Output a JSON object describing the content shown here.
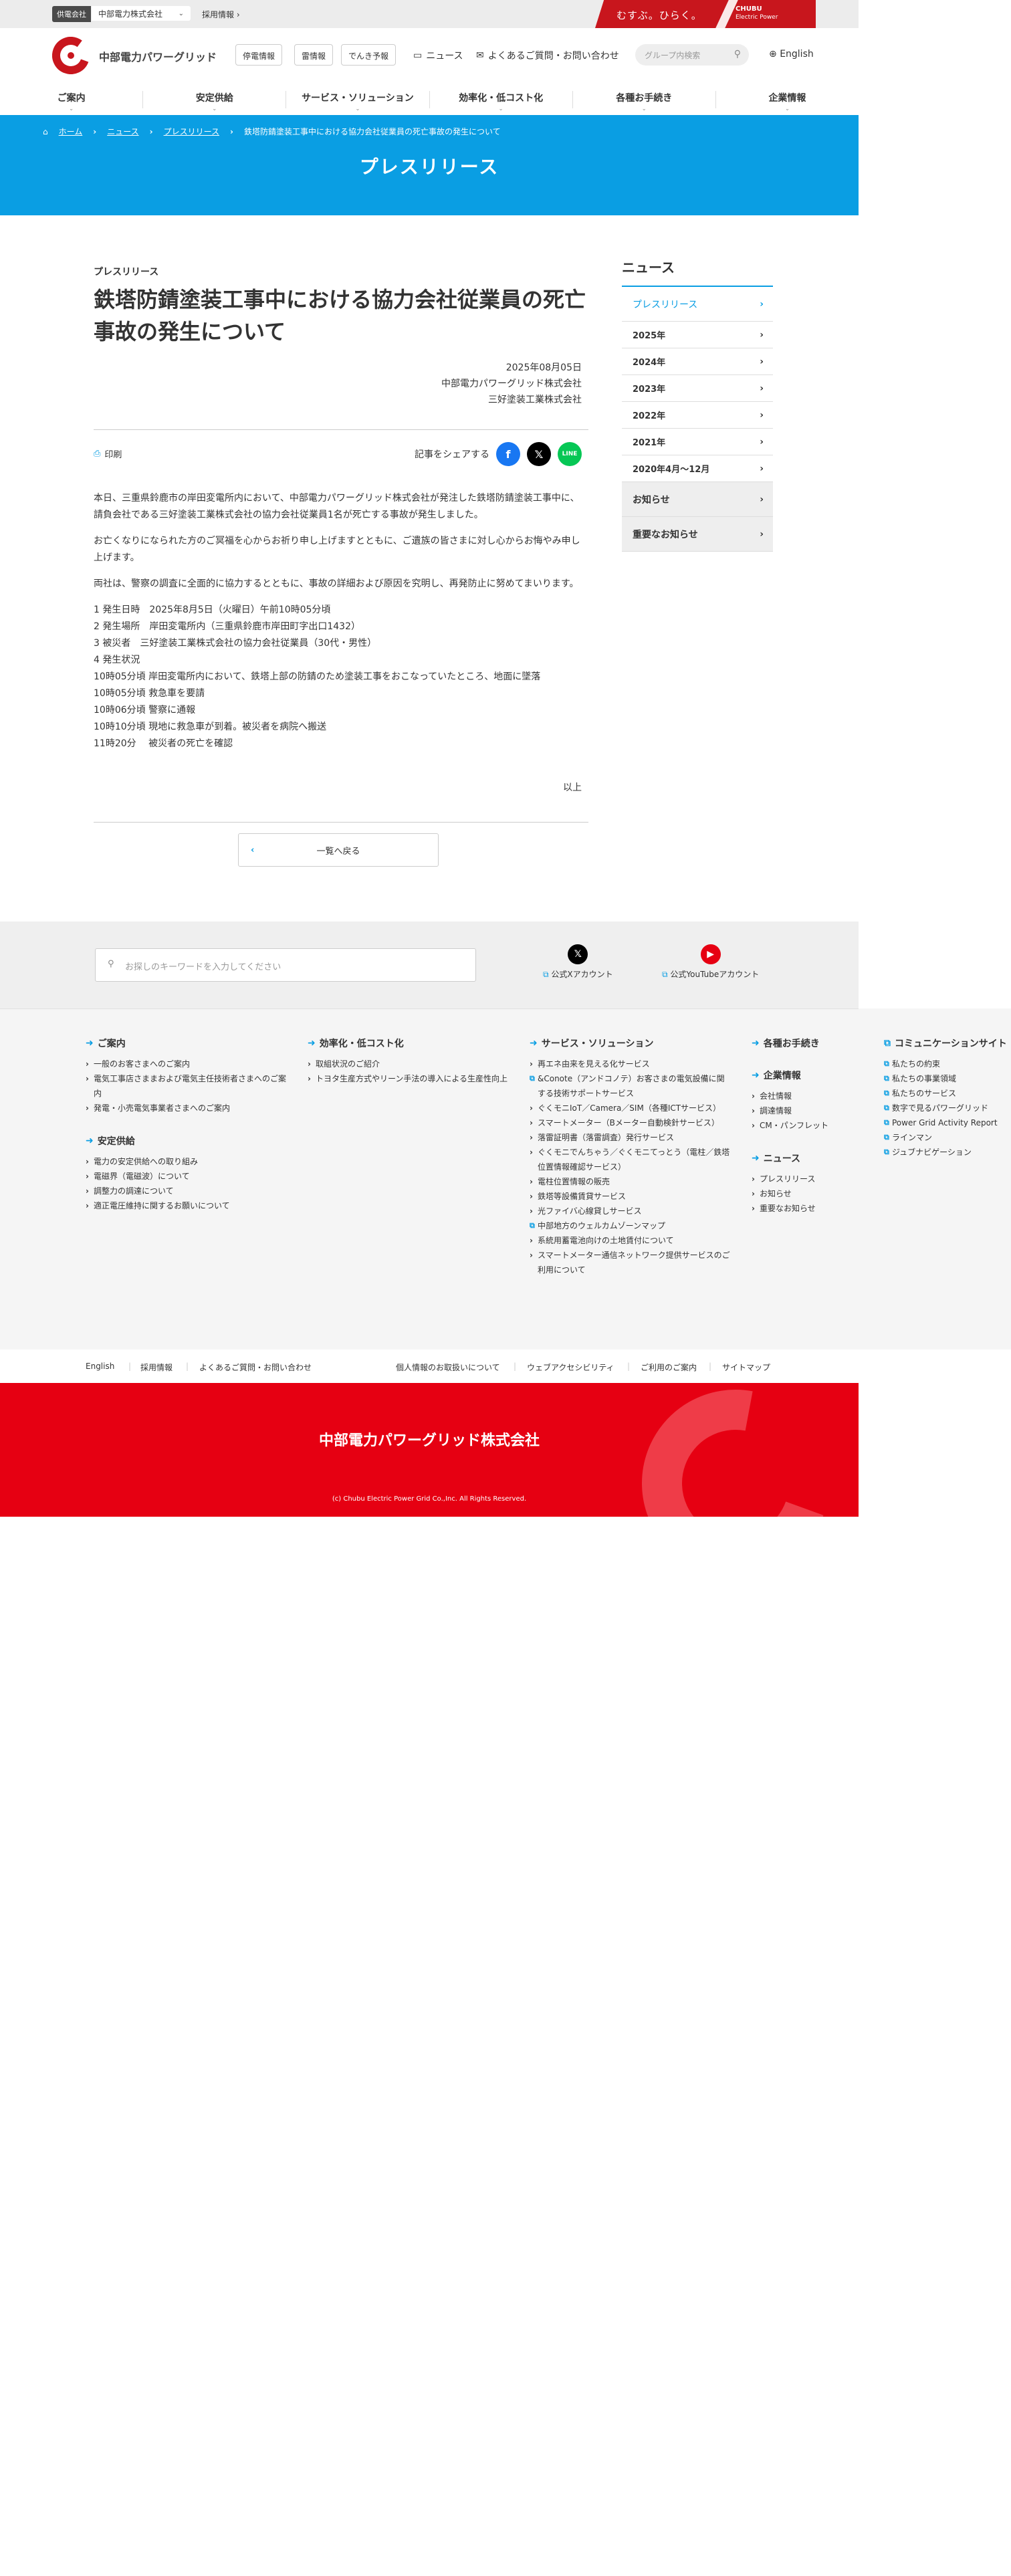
{
  "util": {
    "badge": "供電会社",
    "company": "中部電力株式会社",
    "recruit": "採用情報",
    "slogan": "むすぶ。ひらく。",
    "chubu_ep": "CHUBU",
    "chubu_ep_sub": "Electric Power"
  },
  "header": {
    "logo_text": "中部電力パワーグリッド",
    "btn_outage": "停電情報",
    "btn_lightning": "雷情報",
    "btn_forecast": "でんき予報",
    "news": "ニュース",
    "faq": "よくあるご質問・お問い合わせ",
    "search_placeholder": "グループ内検索",
    "english": "English"
  },
  "nav": [
    "ご案内",
    "安定供給",
    "サービス・ソリューション",
    "効率化・低コスト化",
    "各種お手続き",
    "企業情報"
  ],
  "hero": {
    "crumbs": [
      "ホーム",
      "ニュース",
      "プレスリリース",
      "鉄塔防錆塗装工事中における協力会社従業員の死亡事故の発生について"
    ],
    "title": "プレスリリース"
  },
  "article": {
    "category": "プレスリリース",
    "title": "鉄塔防錆塗装工事中における協力会社従業員の死亡事故の発生について",
    "date": "2025年08月05日",
    "org1": "中部電力パワーグリッド株式会社",
    "org2": "三好塗装工業株式会社",
    "print": "印刷",
    "share_label": "記事をシェアする",
    "p1": "本日、三重県鈴鹿市の岸田変電所内において、中部電力パワーグリッド株式会社が発注した鉄塔防錆塗装工事中に、請負会社である三好塗装工業株式会社の協力会社従業員1名が死亡する事故が発生しました。",
    "p2": "お亡くなりになられた方のご冥福を心からお祈り申し上げますとともに、ご遺族の皆さまに対し心からお悔やみ申し上げます。",
    "p3": "両社は、警察の調査に全面的に協力するとともに、事故の詳細および原因を究明し、再発防止に努めてまいります。",
    "items": [
      "1 発生日時　2025年8月5日（火曜日）午前10時05分頃",
      "2 発生場所　岸田変電所内（三重県鈴鹿市岸田町字出口1432）",
      "3 被災者　三好塗装工業株式会社の協力会社従業員（30代・男性）",
      "4 発生状況",
      "10時05分頃 岸田変電所内において、鉄塔上部の防錆のため塗装工事をおこなっていたところ、地面に墜落",
      "10時05分頃 救急車を要請",
      "10時06分頃 警察に通報",
      "10時10分頃 現地に救急車が到着。被災者を病院へ搬送",
      "11時20分　 被災者の死亡を確認"
    ],
    "end": "以上",
    "back": "一覧へ戻る"
  },
  "side": {
    "title": "ニュース",
    "active": "プレスリリース",
    "years": [
      "2025年",
      "2024年",
      "2023年",
      "2022年",
      "2021年",
      "2020年4月〜12月"
    ],
    "grey": [
      "お知らせ",
      "重要なお知らせ"
    ]
  },
  "footsearch": {
    "placeholder": "お探しのキーワードを入力してください",
    "x_label": "公式Xアカウント",
    "yt_label": "公式YouTubeアカウント"
  },
  "sitemap": {
    "c1_head": "ご案内",
    "c1": [
      "一般のお客さまへのご案内",
      "電気工事店さままおよび電気主任技術者さまへのご案内",
      "発電・小売電気事業者さまへのご案内"
    ],
    "c1b_head": "安定供給",
    "c1b": [
      "電力の安定供給への取り組み",
      "電磁界（電磁波）について",
      "調整力の調達について",
      "適正電圧維持に関するお願いについて"
    ],
    "c2_head": "効率化・低コスト化",
    "c2": [
      "取組状況のご紹介",
      "トヨタ生産方式やリーン手法の導入による生産性向上"
    ],
    "c3_head": "サービス・ソリューション",
    "c3": [
      "再エネ由来を見える化サービス",
      "&Conote（アンドコノテ）お客さまの電気設備に関する技術サポートサービス",
      "ぐくモニIoT／Camera／SIM（各種ICTサービス）",
      "スマートメーター（Bメーター自動検針サービス）",
      "落雷証明書（落雷調査）発行サービス",
      "ぐくモニでんちゃう／ぐくモニてっとう（電柱／鉄塔位置情報確認サービス）",
      "電柱位置情報の販売",
      "鉄塔等設備賃貸サービス",
      "光ファイバ心線貸しサービス",
      "中部地方のウェルカムゾーンマップ",
      "系統用蓄電池向けの土地賃付について",
      "スマートメーター通信ネットワーク提供サービスのご利用について"
    ],
    "c4_head": "各種お手続き",
    "c4b_head": "企業情報",
    "c4b": [
      "会社情報",
      "調達情報",
      "CM・パンフレット"
    ],
    "c4c_head": "ニュース",
    "c4c": [
      "プレスリリース",
      "お知らせ",
      "重要なお知らせ"
    ],
    "c5_head": "コミュニケーションサイト",
    "c5": [
      "私たちの約束",
      "私たちの事業領域",
      "私たちのサービス",
      "数字で見るパワーグリッド",
      "Power Grid Activity Report",
      "ラインマン",
      "ジュブナビゲーション"
    ]
  },
  "bottom": {
    "left": [
      "English",
      "採用情報",
      "よくあるご質問・お問い合わせ"
    ],
    "right": [
      "個人情報のお取扱いについて",
      "ウェブアクセシビリティ",
      "ご利用のご案内",
      "サイトマップ"
    ]
  },
  "footer": {
    "corp": "中部電力パワーグリッド株式会社",
    "copyright": "(c) Chubu Electric Power Grid Co.,Inc. All Rights Reserved."
  },
  "colors": {
    "accent_blue": "#0a9ee3",
    "brand_red": "#e60012",
    "share_fb": "#1877f2",
    "share_x": "#000000",
    "share_line": "#06c755"
  }
}
